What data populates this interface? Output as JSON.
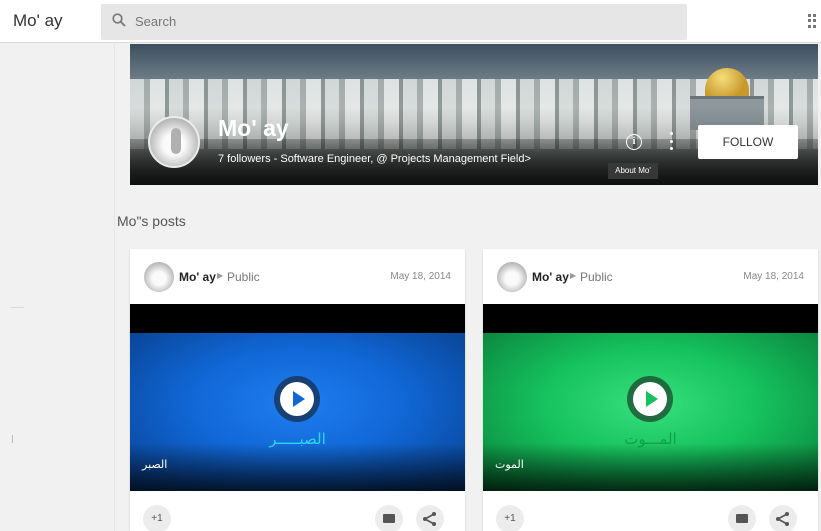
{
  "header": {
    "app_title": "Mo' ay",
    "search_placeholder": "Search"
  },
  "profile": {
    "name": "Mo' ay",
    "tagline": "7 followers - Software Engineer, @ Projects Management Field>",
    "about_label": "About Mo'",
    "follow_label": "FOLLOW"
  },
  "section_title": "Mo\"s posts",
  "posts": [
    {
      "author": "Mo' ay",
      "visibility": "Public",
      "date": "May 18, 2014",
      "video_text": "الصبـــــر",
      "video_caption": "الصبر",
      "plus_one": "+1",
      "accent": "#1167d6"
    },
    {
      "author": "Mo' ay",
      "visibility": "Public",
      "date": "May 18, 2014",
      "video_text": "المـــوت",
      "video_caption": "الموت",
      "plus_one": "+1",
      "accent": "#16c25e"
    }
  ],
  "icons": {
    "search": "search-icon",
    "apps": "apps-grid-icon",
    "info": "info-icon",
    "more": "more-vert-icon",
    "play": "play-icon",
    "comment": "comment-icon",
    "share": "share-icon"
  }
}
